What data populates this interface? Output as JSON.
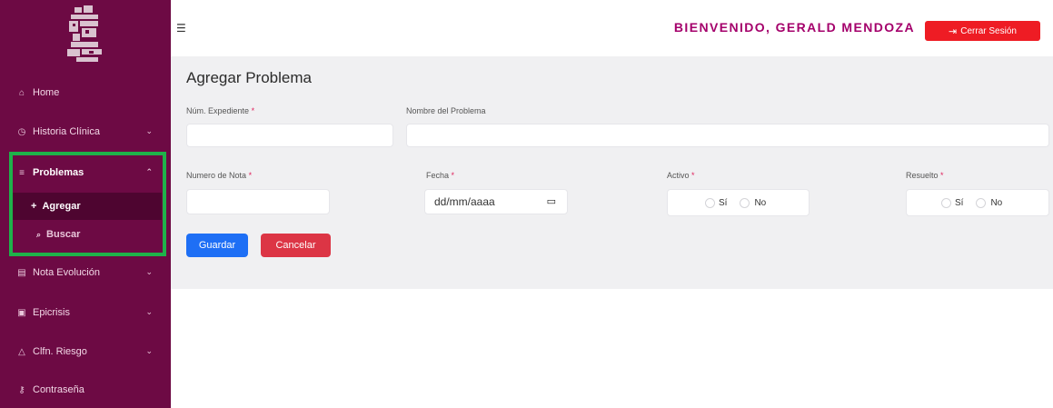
{
  "sidebar": {
    "items": [
      {
        "label": "Home",
        "icon": "home-icon"
      },
      {
        "label": "Historia Clínica",
        "icon": "clock-icon",
        "expandable": true
      },
      {
        "label": "Problemas",
        "icon": "list-icon",
        "expandable": true,
        "expanded": true,
        "active": true
      },
      {
        "label": "Nota Evolución",
        "icon": "notes-icon",
        "expandable": true
      },
      {
        "label": "Epicrisis",
        "icon": "document-icon",
        "expandable": true
      },
      {
        "label": "Clfn. Riesgo",
        "icon": "warning-icon",
        "expandable": true
      },
      {
        "label": "Contraseña",
        "icon": "key-icon"
      }
    ],
    "subitems": [
      {
        "label": "Agregar",
        "icon_glyph": "+",
        "active": true
      },
      {
        "label": "Buscar",
        "icon_glyph": "🔍"
      }
    ],
    "highlight_color": "#1fb24a"
  },
  "header": {
    "welcome": "BIENVENIDO, GERALD MENDOZA",
    "logout_label": "Cerrar Sesión"
  },
  "form": {
    "title": "Agregar Problema",
    "expediente_label": "Núm. Expediente",
    "nombre_label": "Nombre del Problema",
    "nota_label": "Numero de Nota",
    "fecha_label": "Fecha",
    "fecha_placeholder": "dd/mm/aaaa",
    "activo_label": "Activo",
    "resuelto_label": "Resuelto",
    "option_si": "Sí",
    "option_no": "No",
    "required_mark": "*",
    "save_label": "Guardar",
    "cancel_label": "Cancelar"
  },
  "colors": {
    "sidebar_bg": "#6d0a44",
    "accent": "#a4006b",
    "logout_bg": "#ee1c24",
    "save_bg": "#1e6ff5",
    "cancel_bg": "#dc3545"
  }
}
